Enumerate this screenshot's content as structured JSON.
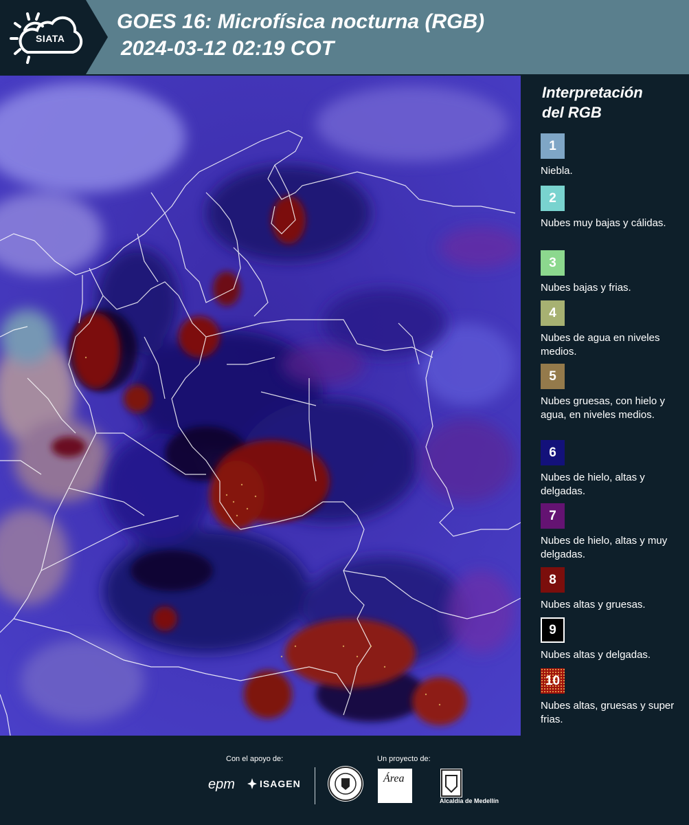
{
  "header": {
    "logo_text": "SIATA",
    "title_line1": "GOES 16: Microfísica nocturna (RGB)",
    "title_line2": "2024-03-12 02:19 COT"
  },
  "legend": {
    "title_line1": "Interpretación",
    "title_line2": "del RGB",
    "items": [
      {
        "number": "1",
        "color": "#7fa6c6",
        "label": "Niebla."
      },
      {
        "number": "2",
        "color": "#79d3cf",
        "label": "Nubes muy bajas y cálidas."
      },
      {
        "number": "3",
        "color": "#8cd88e",
        "label": "Nubes bajas y frias."
      },
      {
        "number": "4",
        "color": "#a7b172",
        "label": "Nubes de agua en niveles medios."
      },
      {
        "number": "5",
        "color": "#947a4b",
        "label": "Nubes gruesas, con hielo y agua, en niveles medios."
      },
      {
        "number": "6",
        "color": "#13117a",
        "label": "Nubes de hielo, altas y delgadas."
      },
      {
        "number": "7",
        "color": "#641372",
        "label": "Nubes de hielo, altas y muy delgadas."
      },
      {
        "number": "8",
        "color": "#7b0e0c",
        "label": "Nubes altas y gruesas."
      },
      {
        "number": "9",
        "color": "#000000",
        "label": "Nubes altas y delgadas."
      },
      {
        "number": "10",
        "color": "#a0120c",
        "label": "Nubes altas, gruesas y super frias."
      }
    ]
  },
  "footer": {
    "support_label": "Con el apoyo de:",
    "project_label": "Un proyecto de:",
    "sponsor1": "epm",
    "sponsor2": "ISAGEN",
    "partner_area": "Área",
    "partner_alcaldia": "Alcaldía de Medellín"
  }
}
